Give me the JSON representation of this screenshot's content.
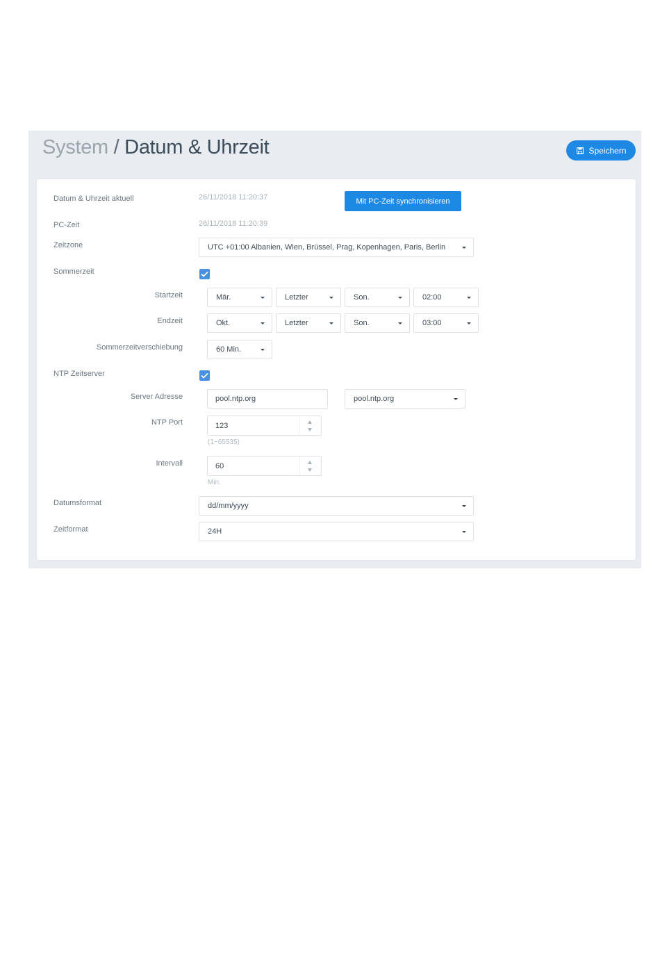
{
  "header": {
    "title_part1": "System",
    "title_separator": " / ",
    "title_part2": "Datum & Uhrzeit",
    "save_label": "Speichern",
    "save_icon": "save-icon"
  },
  "form": {
    "current": {
      "label": "Datum & Uhrzeit aktuell",
      "value": "26/11/2018 11:20:37",
      "sync_label": "Mit PC-Zeit synchronisieren"
    },
    "pc_time": {
      "label": "PC-Zeit",
      "value": "26/11/2018 11:20:39"
    },
    "timezone": {
      "label": "Zeitzone",
      "value": "UTC +01:00 Albanien, Wien, Brüssel, Prag, Kopenhagen, Paris, Berlin"
    },
    "dst": {
      "label": "Sommerzeit",
      "checked": true
    },
    "start": {
      "label": "Startzeit",
      "month": "Mär.",
      "week": "Letzter",
      "day": "Son.",
      "time": "02:00"
    },
    "end": {
      "label": "Endzeit",
      "month": "Okt.",
      "week": "Letzter",
      "day": "Son.",
      "time": "03:00"
    },
    "offset": {
      "label": "Sommerzeitverschiebung",
      "value": "60 Min."
    },
    "ntp": {
      "label": "NTP Zeitserver",
      "checked": true
    },
    "server": {
      "label": "Server Adresse",
      "value": "pool.ntp.org",
      "preset": "pool.ntp.org"
    },
    "port": {
      "label": "NTP Port",
      "value": "123",
      "hint": "(1~65535)"
    },
    "interval": {
      "label": "Intervall",
      "value": "60",
      "hint": "Min."
    },
    "date_format": {
      "label": "Datumsformat",
      "value": "dd/mm/yyyy"
    },
    "time_format": {
      "label": "Zeitformat",
      "value": "24H"
    }
  },
  "colors": {
    "accent": "#1e88e5",
    "checkbox": "#4a90e2",
    "panel_bg": "#e9edf2"
  }
}
